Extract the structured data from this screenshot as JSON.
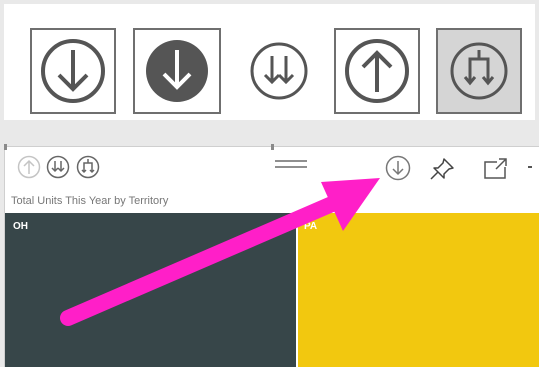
{
  "legend_icons": [
    {
      "icon": "drill-down-icon",
      "state": "active-outlined"
    },
    {
      "icon": "drill-down-icon",
      "state": "filled-dark"
    },
    {
      "icon": "expand-all-down-icon",
      "state": "plain"
    },
    {
      "icon": "drill-up-icon",
      "state": "active-outlined"
    },
    {
      "icon": "expand-next-level-icon",
      "state": "hover-shaded"
    }
  ],
  "visual": {
    "title": "Total Units This Year by Territory",
    "header_icons": [
      "drill-up-icon",
      "expand-all-down-icon",
      "expand-next-level-icon",
      "drill-down-icon",
      "pin-icon",
      "focus-mode-icon",
      "more-options-icon"
    ],
    "tiles": [
      {
        "label": "OH",
        "color": "#374649"
      },
      {
        "label": "PA",
        "color": "#f2c80f"
      }
    ]
  },
  "annotation": {
    "icon": "callout-arrow",
    "color": "#ff1fc8"
  }
}
